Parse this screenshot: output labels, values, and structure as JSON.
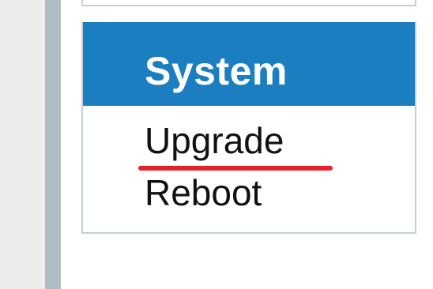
{
  "panel": {
    "title": "System",
    "header_color": "#1b7ec0",
    "items": [
      {
        "label": "Upgrade",
        "highlighted": true
      },
      {
        "label": "Reboot",
        "highlighted": false
      }
    ]
  },
  "highlight_color": "#e8202a"
}
